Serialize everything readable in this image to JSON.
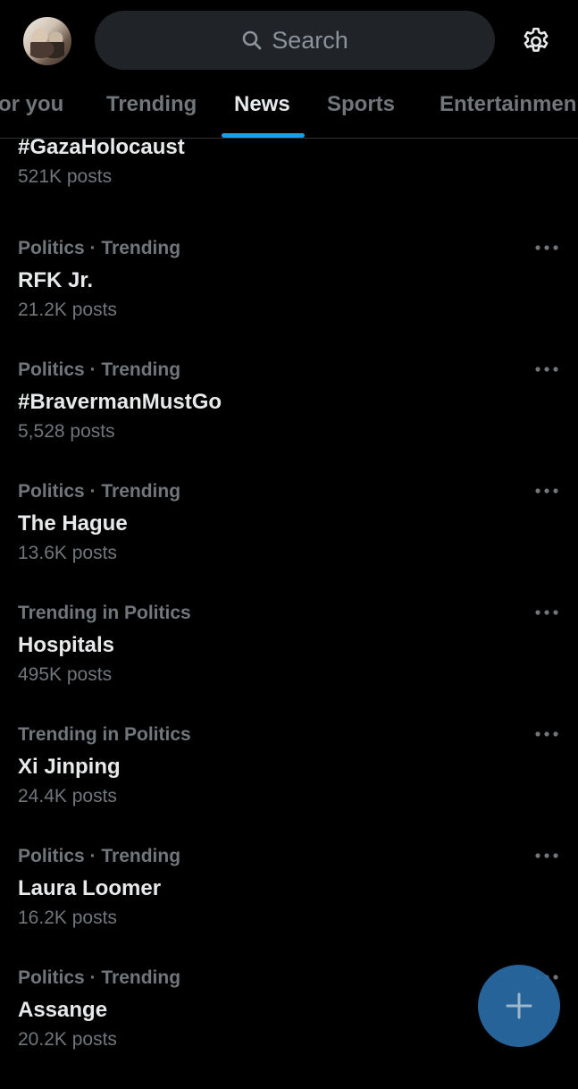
{
  "header": {
    "search_placeholder": "Search"
  },
  "tabs": [
    {
      "label": "For you",
      "visible_label": "or you",
      "active": false
    },
    {
      "label": "Trending",
      "active": false
    },
    {
      "label": "News",
      "active": true
    },
    {
      "label": "Sports",
      "active": false
    },
    {
      "label": "Entertainment",
      "visible_label": "Entertainmen",
      "active": false
    }
  ],
  "trends": [
    {
      "meta": "",
      "title": "#GazaHolocaust",
      "posts": "521K posts"
    },
    {
      "meta": "Politics · Trending",
      "title": "RFK Jr.",
      "posts": "21.2K posts"
    },
    {
      "meta": "Politics · Trending",
      "title": "#BravermanMustGo",
      "posts": "5,528 posts"
    },
    {
      "meta": "Politics · Trending",
      "title": "The Hague",
      "posts": "13.6K posts"
    },
    {
      "meta": "Trending in Politics",
      "title": "Hospitals",
      "posts": "495K posts"
    },
    {
      "meta": "Trending in Politics",
      "title": "Xi Jinping",
      "posts": "24.4K posts"
    },
    {
      "meta": "Politics · Trending",
      "title": "Laura Loomer",
      "posts": "16.2K posts"
    },
    {
      "meta": "Politics · Trending",
      "title": "Assange",
      "posts": "20.2K posts"
    }
  ],
  "icons": {
    "search": "search-icon",
    "settings": "gear-icon",
    "more": "more-icon",
    "compose": "plus-icon"
  },
  "colors": {
    "background": "#000000",
    "text_primary": "#e7e9ea",
    "text_secondary": "#71767b",
    "accent": "#1d9bf0",
    "search_bg": "#202327"
  }
}
